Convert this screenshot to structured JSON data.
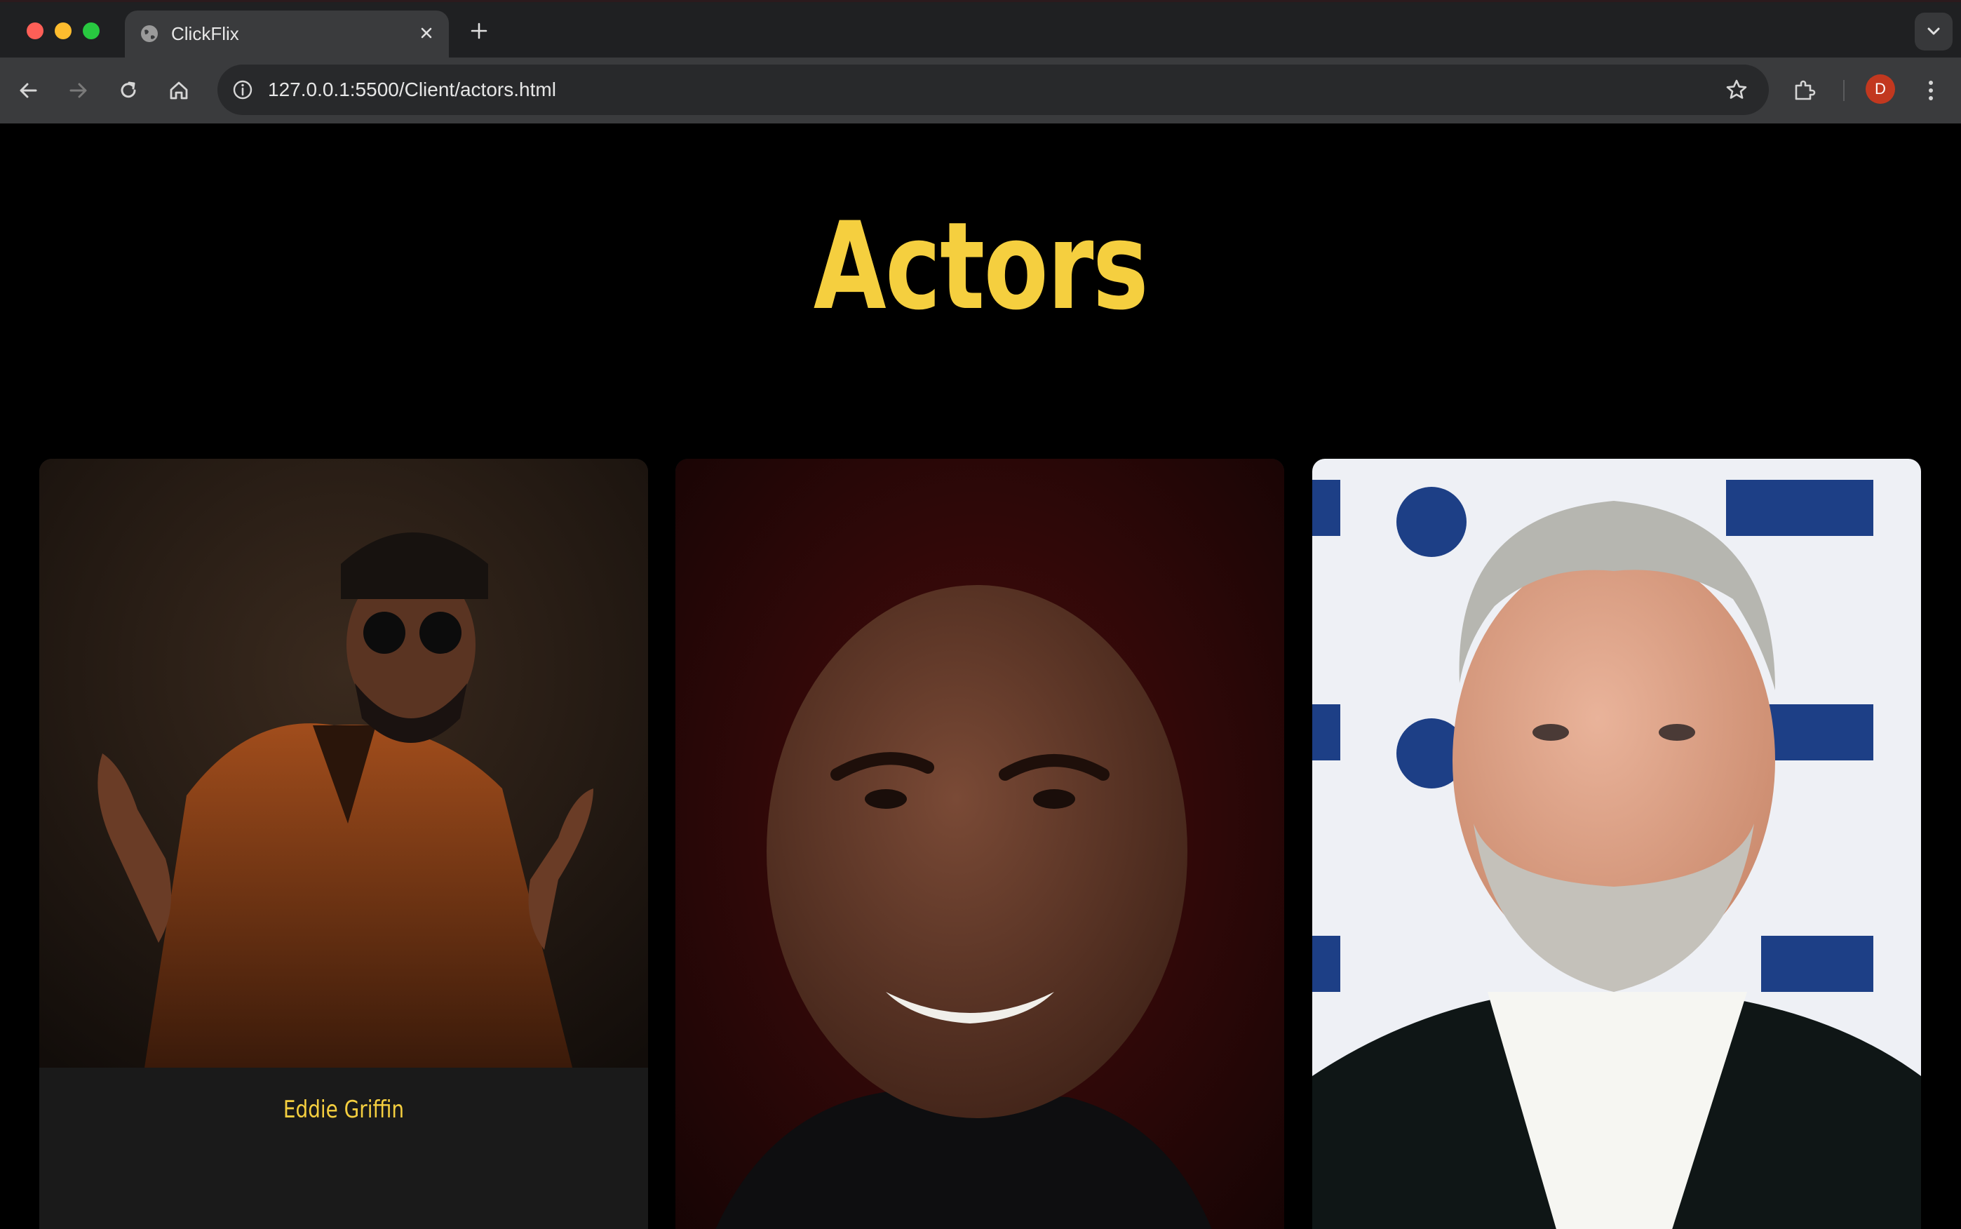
{
  "browser": {
    "tab_title": "ClickFlix",
    "url": "127.0.0.1:5500/Client/actors.html",
    "profile_initial": "D",
    "icons": [
      "globe-icon",
      "close-icon",
      "plus-icon",
      "chevron-down-icon",
      "back-arrow-icon",
      "forward-arrow-icon",
      "reload-icon",
      "home-icon",
      "info-icon",
      "star-icon",
      "puzzle-icon",
      "kebab-menu-icon"
    ]
  },
  "page": {
    "title": "Actors",
    "accent_color": "#f5cf3f",
    "actors": [
      {
        "name": "Eddie Griffin"
      },
      {
        "name": ""
      },
      {
        "name": ""
      }
    ]
  }
}
